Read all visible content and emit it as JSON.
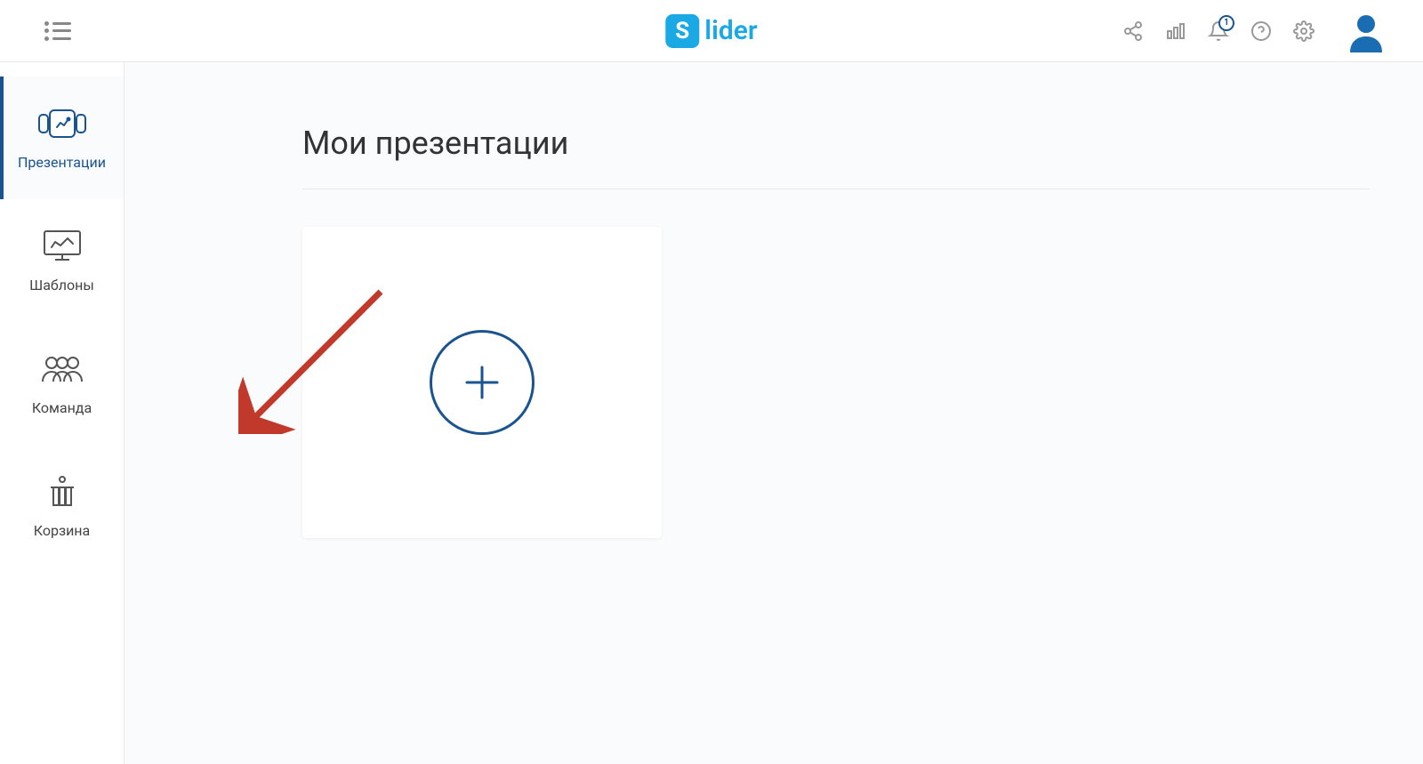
{
  "brand": {
    "name": "lider",
    "icon_letter": "S"
  },
  "header": {
    "notification_count": "1"
  },
  "sidebar": {
    "items": [
      {
        "label": "Презентации",
        "active": true
      },
      {
        "label": "Шаблоны",
        "active": false
      },
      {
        "label": "Команда",
        "active": false
      },
      {
        "label": "Корзина",
        "active": false
      }
    ]
  },
  "main": {
    "title": "Мои презентации"
  }
}
